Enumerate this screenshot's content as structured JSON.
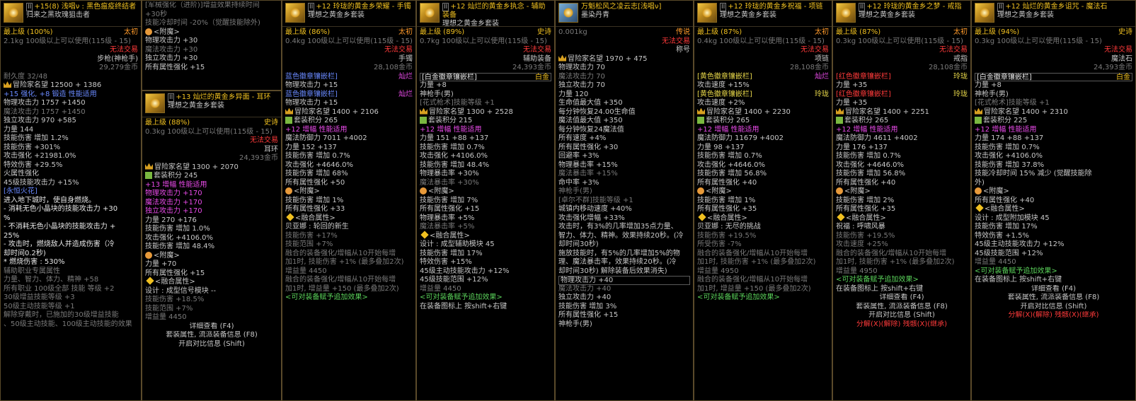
{
  "panels": [
    {
      "id": "p1",
      "title": "+15(8) 浅唱ν : 黑色瘟疫终结者",
      "lock": "II",
      "sub": "归来之黑玫瑰狙击者",
      "lines": [
        {
          "l": "最上级 (100%)",
          "r": "太初",
          "lc": "gold",
          "rc": "orange"
        },
        {
          "l": "2.1kg  100级以上可以使用(115级 - 15)",
          "r": "",
          "lc": "gray"
        },
        {
          "l": "",
          "r": "无法交易",
          "rc": "red"
        },
        {
          "l": "",
          "r": "步枪(神枪手)"
        },
        {
          "l": "",
          "r": "29,279金币",
          "rc": "gray"
        },
        {
          "l": "耐久度 32/48",
          "lc": "gray"
        },
        {
          "l": "冒险家名望 12500 + 1386",
          "crown": true
        },
        {
          "l": "+15 强化, +8 锻造  性能适用",
          "lc": "blue"
        },
        {
          "l": "物理攻击力 1757 +1450"
        },
        {
          "l": "魔法攻击力 1757 +1450",
          "lc": "gray"
        },
        {
          "l": "独立攻击力 970 +585"
        },
        {
          "l": "力量 144"
        },
        {
          "l": "技能伤害 增加 1.2%"
        },
        {
          "l": "技能伤害 +301%"
        },
        {
          "l": "攻击强化 +21981.0%"
        },
        {
          "l": "特效伤害 +29.5%"
        },
        {
          "l": "火属性强化"
        },
        {
          "l": "45级技能攻击力 +15%"
        },
        {
          "l": "[永恒火花]",
          "lc": "blue"
        },
        {
          "l": "进入地下城时，使自身燃烧。",
          "lc": "wht"
        },
        {
          "l": "- 消耗无色小晶块的技能攻击力 +30",
          "lc": "wht"
        },
        {
          "l": "%",
          "lc": "wht"
        },
        {
          "l": "- 不消耗无色小晶块的技能攻击力 +",
          "lc": "wht"
        },
        {
          "l": "25%",
          "lc": "wht"
        },
        {
          "l": "- 攻击时，燃烧敌人并造成伤害（冷",
          "lc": "wht"
        },
        {
          "l": "却时间0.2秒)",
          "lc": "wht"
        },
        {
          "l": "* 燃烧伤害 : 530%",
          "lc": "wht"
        },
        {
          "l": "辅助职业专属属性",
          "lc": "gray"
        },
        {
          "l": "力量、智力、体力、精神 +58",
          "lc": "gray"
        },
        {
          "l": "所有职业 100级全部 技能 等级 +2",
          "lc": "gray"
        },
        {
          "l": "30级增益技能等级 +3",
          "lc": "gray"
        },
        {
          "l": "50级主动技能等级 +1",
          "lc": "gray"
        },
        {
          "l": "解除穿戴时，已施加的30级增益技能",
          "lc": "gray"
        },
        {
          "l": "、50级主动技能、100级主动技能的效果",
          "lc": "gray"
        }
      ]
    },
    {
      "id": "p2",
      "title": "[军械强化（进阶)]增益效果持续时间",
      "top": true,
      "lines": [
        {
          "l": "+30秒",
          "lc": "gray"
        },
        {
          "l": "技能冷却时间 -20%（觉醒技能除外)",
          "lc": "gray"
        },
        {
          "l": "<附魔>",
          "sym": true
        },
        {
          "l": "物理攻击力 +30"
        },
        {
          "l": "魔法攻击力 +30",
          "lc": "gray"
        },
        {
          "l": "独立攻击力 +30"
        },
        {
          "l": "所有属性强化 +15"
        }
      ]
    },
    {
      "id": "p3",
      "title": "+13 灿烂的黄金乡异面 - 耳环",
      "lock": "II",
      "sub": "理想之黄金乡套装",
      "lines": [
        {
          "l": "最上级 (88%)",
          "r": "史诗",
          "lc": "gold",
          "rc": "gold"
        },
        {
          "l": "0.3kg  100级以上可以使用(115级 - 15)",
          "lc": "gray"
        },
        {
          "l": "",
          "r": "无法交易",
          "rc": "red"
        },
        {
          "l": "",
          "r": "耳环"
        },
        {
          "l": "",
          "r": "24,393金币",
          "rc": "gray"
        },
        {
          "l": "冒险家名望 1300 + 2070",
          "crown": true
        },
        {
          "l": "套装积分 245",
          "set": true
        },
        {
          "l": "+13 增幅 性能适用",
          "lc": "pink"
        },
        {
          "l": "物理攻击力 +170",
          "lc": "pink"
        },
        {
          "l": "魔法攻击力 +170",
          "lc": "pink"
        },
        {
          "l": "独立攻击力 +170",
          "lc": "pink"
        },
        {
          "l": "力量 270 +176"
        },
        {
          "l": "技能伤害 增加 1.0%"
        },
        {
          "l": "攻击强化 +4106.0%"
        },
        {
          "l": "技能伤害 增加 48.4%"
        },
        {
          "l": "<附魔>",
          "sym": true
        },
        {
          "l": "力量 +70"
        },
        {
          "l": "所有属性强化 +15"
        },
        {
          "l": "<融合属性>",
          "dia": true
        },
        {
          "l": "设计 : 成型信号模块 --"
        },
        {
          "l": "技能伤害 +18.5%",
          "lc": "gray"
        },
        {
          "l": "技能范围 +7%",
          "lc": "gray"
        },
        {
          "l": "增益量 4450",
          "lc": "gray"
        },
        {
          "l": "详细查看 (F4)",
          "c": true
        },
        {
          "l": "套装属性, 流派装备信息 (F8)",
          "c": true
        },
        {
          "l": "开启对比信息 (Shift)",
          "c": true
        }
      ]
    },
    {
      "id": "p4",
      "title": "+12 玲珑的黄金乡荣耀 - 手镯",
      "lock": "II",
      "sub": "理想之黄金乡套装",
      "lines": [
        {
          "l": "最上级 (86%)",
          "r": "太初",
          "lc": "gold",
          "rc": "orange"
        },
        {
          "l": "0.4kg  100级以上可以使用(115级 - 15)",
          "lc": "gray"
        },
        {
          "l": "",
          "r": "无法交易",
          "rc": "red"
        },
        {
          "l": "",
          "r": "手镯"
        },
        {
          "l": "",
          "r": "28,108金币",
          "rc": "gray"
        },
        {
          "l": "蓝色徽章镶嵌栏]",
          "r": "灿烂",
          "lc": "blue",
          "rc": "pink"
        },
        {
          "l": "物理攻击力 +15"
        },
        {
          "l": "蓝色徽章镶嵌栏]",
          "r": "灿烂",
          "lc": "blue",
          "rc": "pink"
        },
        {
          "l": "物理攻击力 +15"
        },
        {
          "l": "冒险家名望 1400 + 2106",
          "crown": true
        },
        {
          "l": "套装积分 265",
          "set": true
        },
        {
          "l": "+12 增幅 性能适用",
          "lc": "pink"
        },
        {
          "l": "魔法防御力 7011 +4002"
        },
        {
          "l": "力量 152 +137"
        },
        {
          "l": "技能伤害 增加 0.7%"
        },
        {
          "l": "攻击强化 +4646.0%"
        },
        {
          "l": "技能伤害 增加 68%"
        },
        {
          "l": "所有属性强化 +50"
        },
        {
          "l": "<附魔>",
          "sym": true
        },
        {
          "l": "技能伤害 增加 1%"
        },
        {
          "l": "所有属性强化 +33"
        },
        {
          "l": "<融合属性>",
          "dia": true
        },
        {
          "l": "贝亚娜 : 轮回的新生"
        },
        {
          "l": "技能伤害 +17%",
          "lc": "gray"
        },
        {
          "l": "技能范围 +7%",
          "lc": "gray"
        },
        {
          "l": "融合的装备强化/增幅从10开始每增",
          "lc": "gray"
        },
        {
          "l": "加1时, 技能伤害 +1% (最多叠加2次)",
          "lc": "gray"
        },
        {
          "l": "增益量 4450",
          "lc": "gray"
        },
        {
          "l": "融合的装备强化/增幅从10开始每增",
          "lc": "gray"
        },
        {
          "l": "加1时, 增益量 +150 (最多叠加2次)",
          "lc": "gray"
        },
        {
          "l": "<可对装备赋予追加效果>",
          "lc": "green"
        }
      ]
    },
    {
      "id": "p5",
      "title": "+12 灿烂的黄金乡执念 - 辅助装备",
      "lock": "II",
      "sub": "理想之黄金乡套装",
      "lines": [
        {
          "l": "最上级 (89%)",
          "r": "史诗",
          "lc": "gold",
          "rc": "gold"
        },
        {
          "l": "0.7kg  100级以上可以使用(115级 - 15)",
          "lc": "gray"
        },
        {
          "l": "",
          "r": "无法交易",
          "rc": "red"
        },
        {
          "l": "",
          "r": "辅助装备"
        },
        {
          "l": "",
          "r": "24,393金币",
          "rc": "gray"
        },
        {
          "l": "[白金徽章镶嵌栏]",
          "r": "白金",
          "lc": "wht",
          "rc": "gold",
          "box": true
        },
        {
          "l": "力量 +8"
        },
        {
          "l": "神枪手(男)"
        },
        {
          "l": "[花式枪术]技能等级 +1",
          "lc": "gray"
        },
        {
          "l": "冒险家名望 1300 + 2528",
          "crown": true
        },
        {
          "l": "套装积分 215",
          "set": true
        },
        {
          "l": "+12 增幅 性能适用",
          "lc": "pink"
        },
        {
          "l": "力量 151 +88 +137"
        },
        {
          "l": "技能伤害 增加 0.7%"
        },
        {
          "l": "攻击强化 +4106.0%"
        },
        {
          "l": "技能伤害 增加 48.4%"
        },
        {
          "l": "物理暴击率 +30%"
        },
        {
          "l": "魔法暴击率 +30%",
          "lc": "gray"
        },
        {
          "l": "<附魔>",
          "sym": true
        },
        {
          "l": "技能伤害 增加 7%"
        },
        {
          "l": "所有属性强化 +15"
        },
        {
          "l": "物理暴击率 +5%"
        },
        {
          "l": "魔法暴击率 +5%",
          "lc": "gray"
        },
        {
          "l": "<融合属性>",
          "dia": true
        },
        {
          "l": "设计 : 成型辅助模块 45"
        },
        {
          "l": "技能伤害 增加 17%"
        },
        {
          "l": "特效伤害 +15%"
        },
        {
          "l": "45级主动技能攻击力 +12%"
        },
        {
          "l": "45级技能范围 +12%"
        },
        {
          "l": "增益量 4450",
          "lc": "gray"
        },
        {
          "l": "<可对装备赋予追加效果>",
          "lc": "green"
        },
        {
          "l": "在装备图标上 按shift+右键"
        }
      ]
    },
    {
      "id": "p6",
      "title": "万魁松风之凌云志[浅唱ν]",
      "sub": "墨染丹青",
      "scroll": true,
      "lines": [
        {
          "l": "0.001kg",
          "r": "传说",
          "lc": "gray",
          "rc": "orange"
        },
        {
          "l": "",
          "r": "无法交易",
          "rc": "red"
        },
        {
          "l": "",
          "r": "称号"
        },
        {
          "l": "冒险家名望 1970 + 475",
          "crown": true
        },
        {
          "l": "物理攻击力 70"
        },
        {
          "l": "魔法攻击力 70",
          "lc": "gray"
        },
        {
          "l": "独立攻击力 70"
        },
        {
          "l": "力量 120"
        },
        {
          "l": "生命值最大值 +350"
        },
        {
          "l": "每分钟恢复24.00生命值"
        },
        {
          "l": "魔法值最大值 +350"
        },
        {
          "l": "每分钟恢复24魔法值"
        },
        {
          "l": "所有速度 +4%"
        },
        {
          "l": "所有属性强化 +30"
        },
        {
          "l": "回避率 +3%"
        },
        {
          "l": "物理暴击率 +15%"
        },
        {
          "l": "魔法暴击率 +15%",
          "lc": "gray"
        },
        {
          "l": "命中率 +3%"
        },
        {
          "l": "神枪手(男)",
          "lc": "gray"
        },
        {
          "l": "[卓尔不群]技能等级 +1",
          "lc": "gray"
        },
        {
          "l": "城镇内移动速度 +40%"
        },
        {
          "l": "攻击强化增幅 +33%"
        },
        {
          "l": "攻击时，有3%的几率增加35点力量、"
        },
        {
          "l": "智力、体力、精神。效果持续20秒。(冷"
        },
        {
          "l": "却时间30秒)"
        },
        {
          "l": "施放技能时，有5%的几率增加5%的物"
        },
        {
          "l": "理、魔法暴击率，效果持续20秒。(冷"
        },
        {
          "l": "却时间30秒) 解除装备后效果消失)"
        },
        {
          "l": "物理攻击力 +40",
          "box": true
        },
        {
          "l": "魔法攻击力 +40",
          "lc": "gray"
        },
        {
          "l": "独立攻击力 +40"
        },
        {
          "l": "技能伤害 增加 3%"
        },
        {
          "l": "所有属性强化 +15"
        },
        {
          "l": "神枪手(男)"
        }
      ]
    },
    {
      "id": "p7",
      "title": "+12 玲珑的黄金乡祝福 - 项链",
      "lock": "II",
      "sub": "理想之黄金乡套装",
      "lines": [
        {
          "l": "最上级 (87%)",
          "r": "太初",
          "lc": "gold",
          "rc": "orange"
        },
        {
          "l": "0.4kg  100级以上可以使用(115级 - 15)",
          "lc": "gray"
        },
        {
          "l": "",
          "r": "无法交易",
          "rc": "red"
        },
        {
          "l": "",
          "r": "项链"
        },
        {
          "l": "",
          "r": "28,108金币",
          "rc": "gray"
        },
        {
          "l": "[黄色徽章镶嵌栏]",
          "r": "灿烂",
          "lc": "yel",
          "rc": "pink"
        },
        {
          "l": "攻击速度 +15%"
        },
        {
          "l": "[黄色徽章镶嵌栏]",
          "r": "玲珑",
          "lc": "yel",
          "rc": "yel"
        },
        {
          "l": "攻击速度 +2%"
        },
        {
          "l": "冒险家名望 1400 + 2230",
          "crown": true
        },
        {
          "l": "套装积分 265",
          "set": true
        },
        {
          "l": "+12 增幅 性能适用",
          "lc": "pink"
        },
        {
          "l": "魔法防御力 11679 +4002"
        },
        {
          "l": "力量 98 +137"
        },
        {
          "l": "技能伤害 增加 0.7%"
        },
        {
          "l": "攻击强化 +4646.0%"
        },
        {
          "l": "技能伤害 增加 56.8%"
        },
        {
          "l": "所有属性强化 +40"
        },
        {
          "l": "<附魔>",
          "sym": true
        },
        {
          "l": "技能伤害 增加 1%"
        },
        {
          "l": "所有属性强化 +35"
        },
        {
          "l": "<融合属性>",
          "dia": true
        },
        {
          "l": "贝亚娜 : 无尽的挑战"
        },
        {
          "l": "技能伤害 +19.5%",
          "lc": "gray"
        },
        {
          "l": "所受伤害 -7%",
          "lc": "gray"
        },
        {
          "l": "融合的装备强化/增幅从10开始每增",
          "lc": "gray"
        },
        {
          "l": "加1时, 技能伤害 +1% (最多叠加2次)",
          "lc": "gray"
        },
        {
          "l": "增益量 4950",
          "lc": "gray"
        },
        {
          "l": "融合的装备强化/增幅从10开始每增",
          "lc": "gray"
        },
        {
          "l": "加1时, 增益量 +150 (最多叠加2次)",
          "lc": "gray"
        },
        {
          "l": "<可对装备赋予追加效果>",
          "lc": "green"
        }
      ]
    },
    {
      "id": "p8",
      "title": "+12 玲珑的黄金乡之梦 - 戒指",
      "lock": "II",
      "sub": "理想之黄金乡套装",
      "lines": [
        {
          "l": "最上级 (87%)",
          "r": "太初",
          "lc": "gold",
          "rc": "orange"
        },
        {
          "l": "0.3kg  100级以上可以使用(115级 - 15)",
          "lc": "gray"
        },
        {
          "l": "",
          "r": "无法交易",
          "rc": "red"
        },
        {
          "l": "",
          "r": "戒指"
        },
        {
          "l": "",
          "r": "28,108金币",
          "rc": "gray"
        },
        {
          "l": "[红色徽章镶嵌栏]",
          "r": "玲珑",
          "lc": "red",
          "rc": "yel"
        },
        {
          "l": "力量 +35"
        },
        {
          "l": "[红色徽章镶嵌栏]",
          "r": "玲珑",
          "lc": "red",
          "rc": "yel"
        },
        {
          "l": "力量 +35"
        },
        {
          "l": "冒险家名望 1400 + 2251",
          "crown": true
        },
        {
          "l": "套装积分 265",
          "set": true
        },
        {
          "l": "+12 增幅 性能适用",
          "lc": "pink"
        },
        {
          "l": "魔法防御力 4611 +4002"
        },
        {
          "l": "力量 176 +137"
        },
        {
          "l": "技能伤害 增加 0.7%"
        },
        {
          "l": "攻击强化 +4646.0%"
        },
        {
          "l": "技能伤害 增加 56.8%"
        },
        {
          "l": "所有属性强化 +40"
        },
        {
          "l": "<附魔>",
          "sym": true
        },
        {
          "l": "技能伤害 增加 2%"
        },
        {
          "l": "所有属性强化 +35"
        },
        {
          "l": "<融合属性>",
          "dia": true
        },
        {
          "l": "祝福 : 呼啸风暴"
        },
        {
          "l": "技能伤害 +19.5%",
          "lc": "gray"
        },
        {
          "l": "攻击速度 +25%",
          "lc": "gray"
        },
        {
          "l": "融合的装备强化/增幅从10开始每增",
          "lc": "gray"
        },
        {
          "l": "加1时, 技能伤害 +1% (最多叠加2次)",
          "lc": "gray"
        },
        {
          "l": "增益量 4950",
          "lc": "gray"
        },
        {
          "l": "<可对装备赋予追加效果>",
          "lc": "green"
        },
        {
          "l": "在装备图标上 按shift+右键"
        },
        {
          "l": "详细查看 (F4)",
          "c": true
        },
        {
          "l": "套装属性, 流派装备信息 (F8)",
          "c": true
        },
        {
          "l": "开启对比信息 (Shift)",
          "c": true
        },
        {
          "l": "分解(X)(解除)  残骸(X)(继承)",
          "c": true,
          "lc": "red"
        }
      ]
    },
    {
      "id": "p9",
      "title": "+12 灿烂的黄金乡诅咒 - 魔法石",
      "lock": "II",
      "sub": "理想之黄金乡套装",
      "lines": [
        {
          "l": "最上级 (94%)",
          "r": "史诗",
          "lc": "gold",
          "rc": "gold"
        },
        {
          "l": "0.3kg  100级以上可以使用(115级 - 15)",
          "lc": "gray"
        },
        {
          "l": "",
          "r": "无法交易",
          "rc": "red"
        },
        {
          "l": "",
          "r": "魔法石"
        },
        {
          "l": "",
          "r": "24,393金币",
          "rc": "gray"
        },
        {
          "l": "[白金徽章镶嵌栏]",
          "r": "白金",
          "lc": "wht",
          "rc": "gold",
          "box": true
        },
        {
          "l": "力量 +8"
        },
        {
          "l": "神枪手(男)"
        },
        {
          "l": "[花式枪术]技能等级 +1",
          "lc": "gray"
        },
        {
          "l": "冒险家名望 1400 + 2310",
          "crown": true
        },
        {
          "l": "套装积分 225",
          "set": true
        },
        {
          "l": "+12 增幅 性能适用",
          "lc": "pink"
        },
        {
          "l": "力量 174 +88 +137"
        },
        {
          "l": "技能伤害 增加 0.7%"
        },
        {
          "l": "攻击强化 +4106.0%"
        },
        {
          "l": "技能伤害 增加 37.8%"
        },
        {
          "l": "技能冷却时间 15% 减少 (觉醒技能除"
        },
        {
          "l": "外)"
        },
        {
          "l": "<附魔>",
          "sym": true
        },
        {
          "l": "所有属性强化 +40"
        },
        {
          "l": "<融合属性>",
          "dia": true
        },
        {
          "l": "设计 : 成型附加模块 45"
        },
        {
          "l": "技能伤害 增加 17%"
        },
        {
          "l": "特效伤害 +1.5%"
        },
        {
          "l": "45级主动技能攻击力 +12%"
        },
        {
          "l": "45级技能范围 +12%"
        },
        {
          "l": "增益量 4450",
          "lc": "gray"
        },
        {
          "l": "<可对装备赋予追加效果>",
          "lc": "green"
        },
        {
          "l": "在装备图标上 按shift+右键"
        },
        {
          "l": "详细查看 (F4)",
          "c": true
        },
        {
          "l": "套装属性, 流派装备信息 (F8)",
          "c": true
        },
        {
          "l": "开启对比信息 (Shift)",
          "c": true
        },
        {
          "l": "分解(X)(解除)  残骸(X)(继承)",
          "c": true,
          "lc": "red"
        }
      ]
    }
  ]
}
